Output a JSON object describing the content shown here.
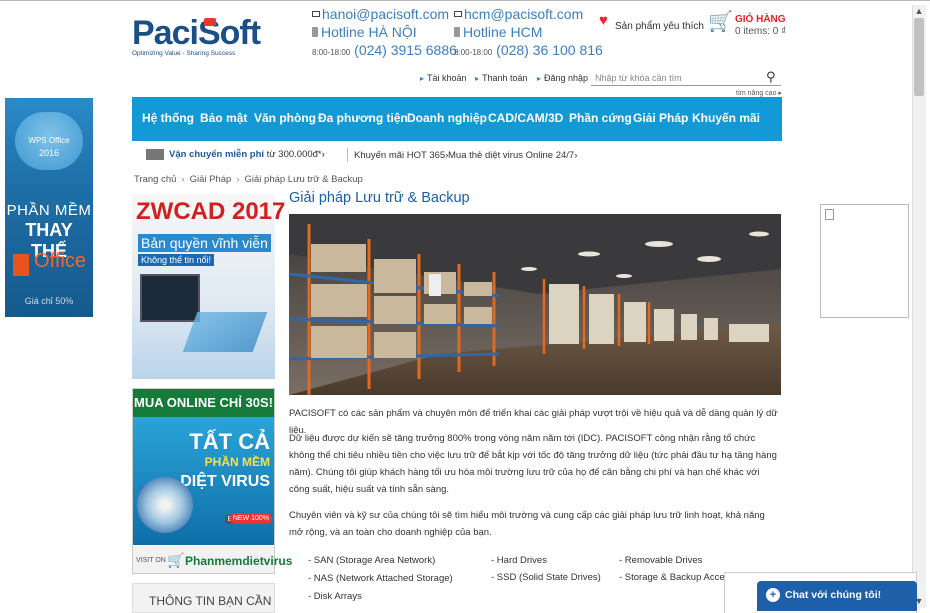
{
  "left_ad": {
    "product": "WPS Office",
    "year": "2016",
    "line1": "PHẦN MỀM",
    "line2": "THAY THẾ",
    "line3": "Office",
    "line4": "Giá chỉ 50%"
  },
  "header": {
    "logo_text": "PaciSoft",
    "logo_tagline": "Optimizing Value - Sharing Success",
    "hanoi": {
      "email": "hanoi@pacisoft.com",
      "hotline": "Hotline HÀ NỘI",
      "hours": "8:00-18:00",
      "phone": "(024) 3915 6886"
    },
    "hcm": {
      "email": "hcm@pacisoft.com",
      "hotline": "Hotline HCM",
      "hours": "8:00-18:00",
      "phone": "(028) 36 100 816"
    },
    "favorites": "Sản phẩm yêu thích",
    "cart_title": "GIỎ HÀNG",
    "cart_items": "0 items: 0 ₫"
  },
  "topnav": {
    "account": "Tài khoản",
    "checkout": "Thanh toán",
    "login": "Đăng nhập",
    "search_placeholder": "Nhập từ khóa cần tìm",
    "advanced": "tìm nâng cao ▸"
  },
  "mainnav": [
    "Hệ thống",
    "Bảo mật",
    "Văn phòng",
    "Đa phương tiện",
    "Doanh nghiệp",
    "CAD/CAM/3D",
    "Phần cứng",
    "Giải Pháp",
    "Khuyến mãi"
  ],
  "promo": {
    "shipping": "Vận chuyển miễn phí",
    "shipping_amount": "từ 300.000đ*",
    "hot": "Khuyến mãi HOT 365",
    "virus": "Mua thẻ diệt virus Online 24/7"
  },
  "breadcrumb": [
    "Trang chủ",
    "Giải Pháp",
    "Giải pháp Lưu trữ & Backup"
  ],
  "sidebar": {
    "zwcad": {
      "title": "ZWCAD 2017",
      "sub": "Bản quyền vĩnh viễn",
      "sub2": "Không thể tin nổi!"
    },
    "online": {
      "header": "MUA ONLINE CHỈ 30S!",
      "b1": "TẤT CẢ",
      "b2": "PHẦN MỀM",
      "b3": "DIỆT VIRUS",
      "brand": "BRAND",
      "new": "NEW 100%",
      "visit": "VISIT ON",
      "site": "Phanmemdietvirus"
    },
    "info_title": "THÔNG TIN BẠN CẦN"
  },
  "content": {
    "title": "Giải pháp Lưu trữ & Backup",
    "p1": "PACISOFT có các sản phẩm và chuyên môn để triển khai các giải pháp vượt trội về hiệu quả và dễ dàng quản lý dữ liệu.",
    "p2": "Dữ liệu được dự kiến sẽ tăng trưởng 800% trong vòng năm năm tới (IDC). PACISOFT công nhận rằng tổ chức không thể chi tiêu nhiều tiền cho việc lưu trữ để bắt kịp với tốc độ tăng trưởng dữ liệu (tức phải đầu tư hạ tầng hàng năm). Chúng tôi giúp khách hàng tối ưu hóa môi trường lưu trữ của họ để cân bằng chi phí và hạn chế khác với công suất, hiệu suất và tính sẵn sàng.",
    "p3": "Chuyên viên và kỹ sư của chúng tôi sẽ tìm hiểu môi trường và cung cấp các giải pháp lưu trữ linh hoạt, khả năng mở rộng, và an toàn cho doanh nghiệp của bạn.",
    "list_col1": [
      "- SAN (Storage Area Network)",
      "- NAS (Network Attached Storage)",
      "- Disk Arrays"
    ],
    "list_col2": [
      "- Hard Drives",
      "- SSD (Solid State Drives)"
    ],
    "list_col3": [
      "- Removable Drives",
      "- Storage & Backup Access"
    ]
  },
  "chat": {
    "label": "Chat với chúng tôi!"
  }
}
